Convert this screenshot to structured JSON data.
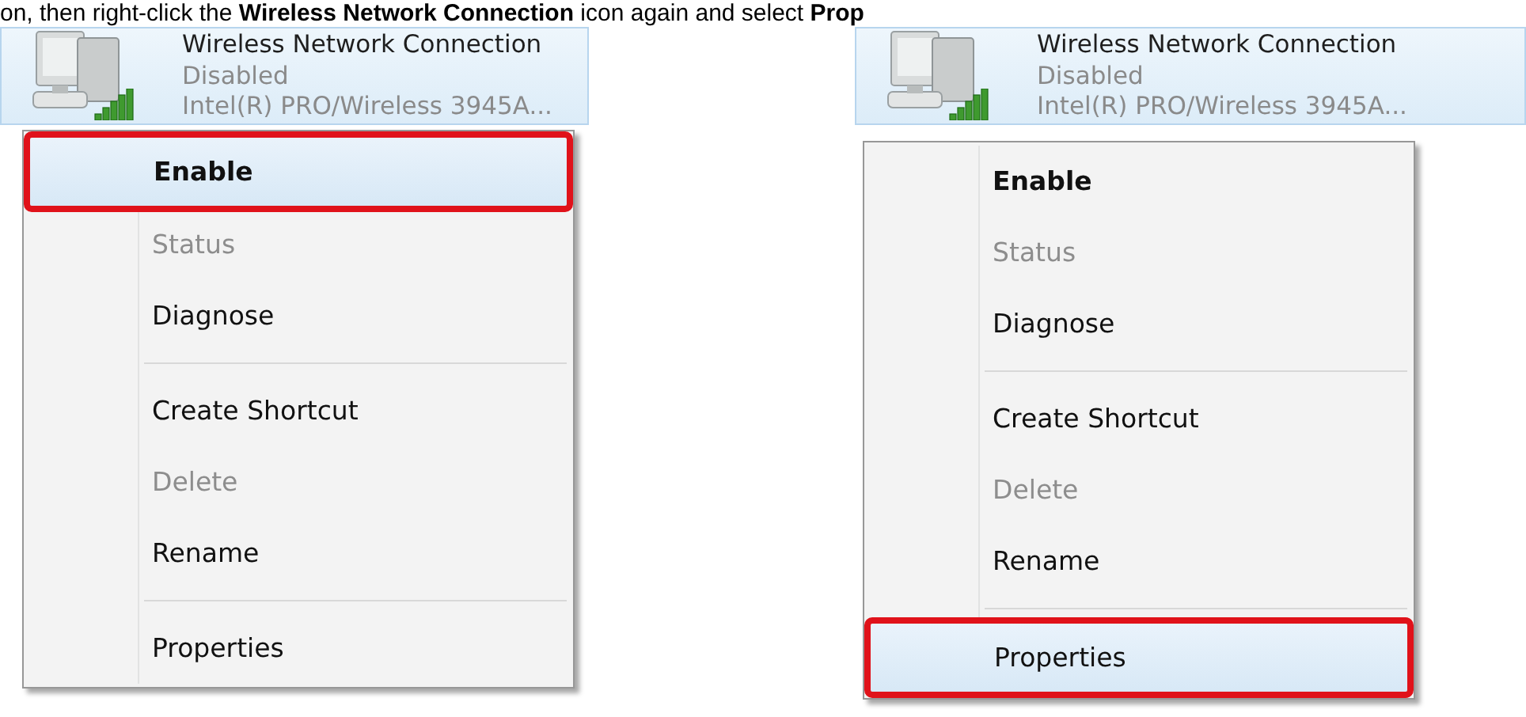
{
  "caption": "on, then right-click the **Wireless Network Connection** icon again and select **Prop**",
  "panels": [
    {
      "adapter": {
        "name": "Wireless Network Connection",
        "status": "Disabled",
        "device": "Intel(R) PRO/Wireless 3945A..."
      },
      "menu": {
        "groups": [
          [
            {
              "label": "Enable",
              "default": true,
              "disabled": false,
              "selected": true,
              "marked": true
            },
            {
              "label": "Status",
              "default": false,
              "disabled": true,
              "selected": false,
              "marked": false
            },
            {
              "label": "Diagnose",
              "default": false,
              "disabled": false,
              "selected": false,
              "marked": false
            }
          ],
          [
            {
              "label": "Create Shortcut",
              "default": false,
              "disabled": false,
              "selected": false,
              "marked": false
            },
            {
              "label": "Delete",
              "default": false,
              "disabled": true,
              "selected": false,
              "marked": false
            },
            {
              "label": "Rename",
              "default": false,
              "disabled": false,
              "selected": false,
              "marked": false
            }
          ],
          [
            {
              "label": "Properties",
              "default": false,
              "disabled": false,
              "selected": false,
              "marked": false
            }
          ]
        ]
      }
    },
    {
      "adapter": {
        "name": "Wireless Network Connection",
        "status": "Disabled",
        "device": "Intel(R) PRO/Wireless 3945A..."
      },
      "menu": {
        "groups": [
          [
            {
              "label": "Enable",
              "default": true,
              "disabled": false,
              "selected": false,
              "marked": false
            },
            {
              "label": "Status",
              "default": false,
              "disabled": true,
              "selected": false,
              "marked": false
            },
            {
              "label": "Diagnose",
              "default": false,
              "disabled": false,
              "selected": false,
              "marked": false
            }
          ],
          [
            {
              "label": "Create Shortcut",
              "default": false,
              "disabled": false,
              "selected": false,
              "marked": false
            },
            {
              "label": "Delete",
              "default": false,
              "disabled": true,
              "selected": false,
              "marked": false
            },
            {
              "label": "Rename",
              "default": false,
              "disabled": false,
              "selected": false,
              "marked": false
            }
          ],
          [
            {
              "label": "Properties",
              "default": false,
              "disabled": false,
              "selected": true,
              "marked": true
            }
          ]
        ]
      }
    }
  ]
}
